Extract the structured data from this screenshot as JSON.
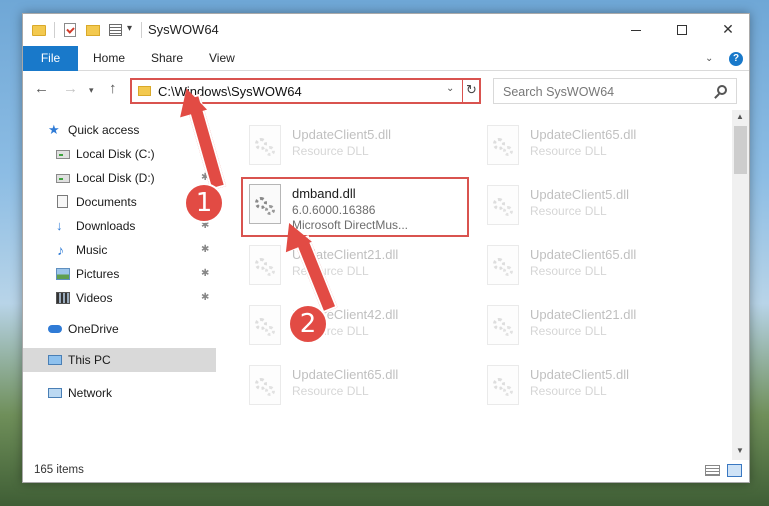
{
  "window": {
    "title": "SysWOW64"
  },
  "ribbon": {
    "file": "File",
    "home": "Home",
    "share": "Share",
    "view": "View"
  },
  "address": {
    "path": "C:\\Windows\\SysWOW64"
  },
  "search": {
    "placeholder": "Search SysWOW64"
  },
  "sidebar": {
    "items": [
      {
        "label": "Quick access"
      },
      {
        "label": "Local Disk (C:)"
      },
      {
        "label": "Local Disk (D:)"
      },
      {
        "label": "Documents"
      },
      {
        "label": "Downloads"
      },
      {
        "label": "Music"
      },
      {
        "label": "Pictures"
      },
      {
        "label": "Videos"
      },
      {
        "label": "OneDrive"
      },
      {
        "label": "This PC"
      },
      {
        "label": "Network"
      }
    ]
  },
  "files": [
    {
      "name": "UpdateClient5.dll",
      "line2": "Resource DLL",
      "line3": ""
    },
    {
      "name": "UpdateClient65.dll",
      "line2": "Resource DLL",
      "line3": ""
    },
    {
      "name": "dmband.dll",
      "line2": "6.0.6000.16386",
      "line3": "Microsoft DirectMus..."
    },
    {
      "name": "UpdateClient5.dll",
      "line2": "Resource DLL",
      "line3": ""
    },
    {
      "name": "UpdateClient21.dll",
      "line2": "Resource DLL",
      "line3": ""
    },
    {
      "name": "UpdateClient65.dll",
      "line2": "Resource DLL",
      "line3": ""
    },
    {
      "name": "UpdateClient42.dll",
      "line2": "Resource DLL",
      "line3": ""
    },
    {
      "name": "UpdateClient21.dll",
      "line2": "Resource DLL",
      "line3": ""
    },
    {
      "name": "UpdateClient65.dll",
      "line2": "Resource DLL",
      "line3": ""
    },
    {
      "name": "UpdateClient5.dll",
      "line2": "Resource DLL",
      "line3": ""
    }
  ],
  "status": {
    "items": "165 items"
  },
  "annotations": {
    "step1": "1",
    "step2": "2",
    "color": "#e24b44"
  }
}
